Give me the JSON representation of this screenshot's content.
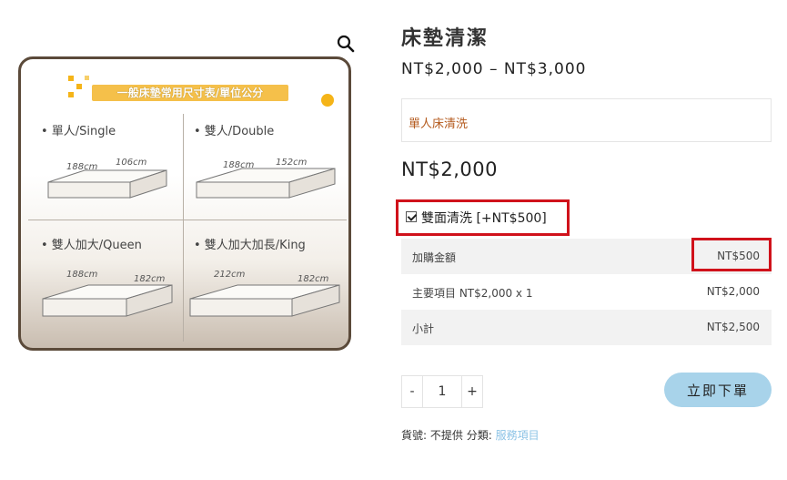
{
  "image": {
    "chart_title": "一般床墊常用尺寸表/單位公分",
    "sizes": [
      {
        "label": "• 單人/Single",
        "length": "188cm",
        "width": "106cm"
      },
      {
        "label": "• 雙人/Double",
        "length": "188cm",
        "width": "152cm"
      },
      {
        "label": "• 雙人加大/Queen",
        "length": "188cm",
        "width": "182cm"
      },
      {
        "label": "• 雙人加大加長/King",
        "length": "212cm",
        "width": "182cm"
      }
    ],
    "colors": {
      "frame": "#5b4a3a",
      "title_bar": "#f5c04a",
      "accent_dot": "#f5b418"
    }
  },
  "product": {
    "title": "床墊清潔",
    "price_range": "NT$2,000 – NT$3,000",
    "selected_variant": "單人床清洗",
    "current_price": "NT$2,000"
  },
  "addon": {
    "label": "雙面清洗 [+NT$500]",
    "checked": true
  },
  "totals": [
    {
      "label": "加購金額",
      "value": "NT$500"
    },
    {
      "label": "主要項目 NT$2,000 x 1",
      "value": "NT$2,000"
    },
    {
      "label": "小計",
      "value": "NT$2,500"
    }
  ],
  "quantity": {
    "minus": "-",
    "value": "1",
    "plus": "+"
  },
  "buy_button": "立即下單",
  "meta": {
    "sku_label": "貨號:",
    "sku_value": "不提供",
    "category_label": "分類:",
    "category_link": "服務項目"
  },
  "icons": {
    "zoom": "search-icon"
  },
  "colors": {
    "highlight": "#d0121b",
    "button": "#a8d3ea",
    "variant_text": "#b45a1d",
    "link": "#8cc3e6"
  }
}
